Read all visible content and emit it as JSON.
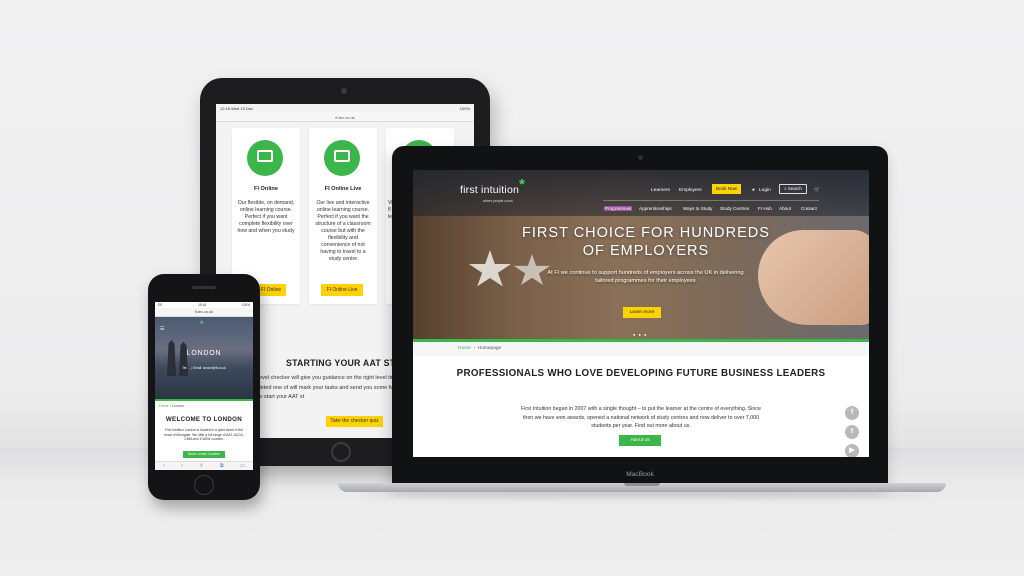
{
  "tablet": {
    "status_time": "12:16  Wed 19 Dec",
    "status_right": "100%",
    "url": "fi-tec.co.uk",
    "cards": [
      {
        "title": "FI Online",
        "description": "Our flexible, on demand, online learning course. Perfect if you want complete flexibility over how and when you study",
        "button": "FI Online"
      },
      {
        "title": "FI Online Live",
        "description": "Our live and interactive online learning course. Perfect if you want the structure of a classroom course but with the flexibility and convenience of not having to travel to a study centre",
        "button": "FI Online Live"
      },
      {
        "title": "",
        "description": "Visi am fl lea th le",
        "button": ""
      }
    ],
    "heading": "STARTING YOUR AAT STUDIES",
    "paragraph": "AAT level checker will give you guidance on the right level ting Qualification to start at. Once completed one of will mark your tasks and send you some feedback as on which level would be best to start your AAT st",
    "quiz_button": "Take the checker quiz"
  },
  "laptop": {
    "brand": "MacBook",
    "logo": "first intuition",
    "logo_asterisk": "*",
    "tagline": "where people count",
    "nav_top": {
      "learners": "Learners",
      "employers": "Employers",
      "book_now": "Book Now",
      "login": "Login",
      "search": "Search",
      "cart": "🛒"
    },
    "nav_bottom": [
      "Programmes",
      "Apprenticeships",
      "Ways to Study",
      "Study Centres",
      "FI Hub",
      "About",
      "Contact"
    ],
    "hero_heading": "FIRST CHOICE FOR HUNDREDS OF EMPLOYERS",
    "hero_text": "At FI we continue to support hundreds of employers across the UK in delivering tailored programmes for their employees",
    "hero_button": "Learn more",
    "slider_dots": "● ● ●",
    "breadcrumb_home": "Home",
    "breadcrumb_sep": "›",
    "breadcrumb_current": "Homepage",
    "section_heading": "PROFESSIONALS WHO LOVE DEVELOPING FUTURE BUSINESS LEADERS",
    "section_text": "First Intuition began in 2007 with a single thought – to put the learner at the centre of everything. Since then we have won awards, opened a national network of study centres and now deliver to over 7,000 students per year. Find out more about us.",
    "section_button": "About us",
    "social_icons": [
      "f",
      "t",
      "▶"
    ]
  },
  "phone": {
    "status_left": "EE",
    "status_time": "15:16",
    "status_right": "100%",
    "url": "fi-tec.co.uk",
    "menu_icon": "☰",
    "logo_asterisk": "*",
    "city": "LONDON",
    "hero_line": "Tel: ... | Email: london@fi.co.uk",
    "breadcrumb_home": "Home",
    "breadcrumb_current": "London",
    "heading": "WELCOME TO LONDON",
    "paragraph": "First Intuition London is located in a quiet street in the heart of Moorgate. We offer a full range of AAT, ACCA, CIMA and ICAEW courses.",
    "button": "Book London Courses",
    "toolbar": [
      "‹",
      "›",
      "⇧",
      "⧉",
      "▭"
    ]
  },
  "colors": {
    "accent_green": "#3cb54a",
    "button_yellow": "#ffd200"
  }
}
